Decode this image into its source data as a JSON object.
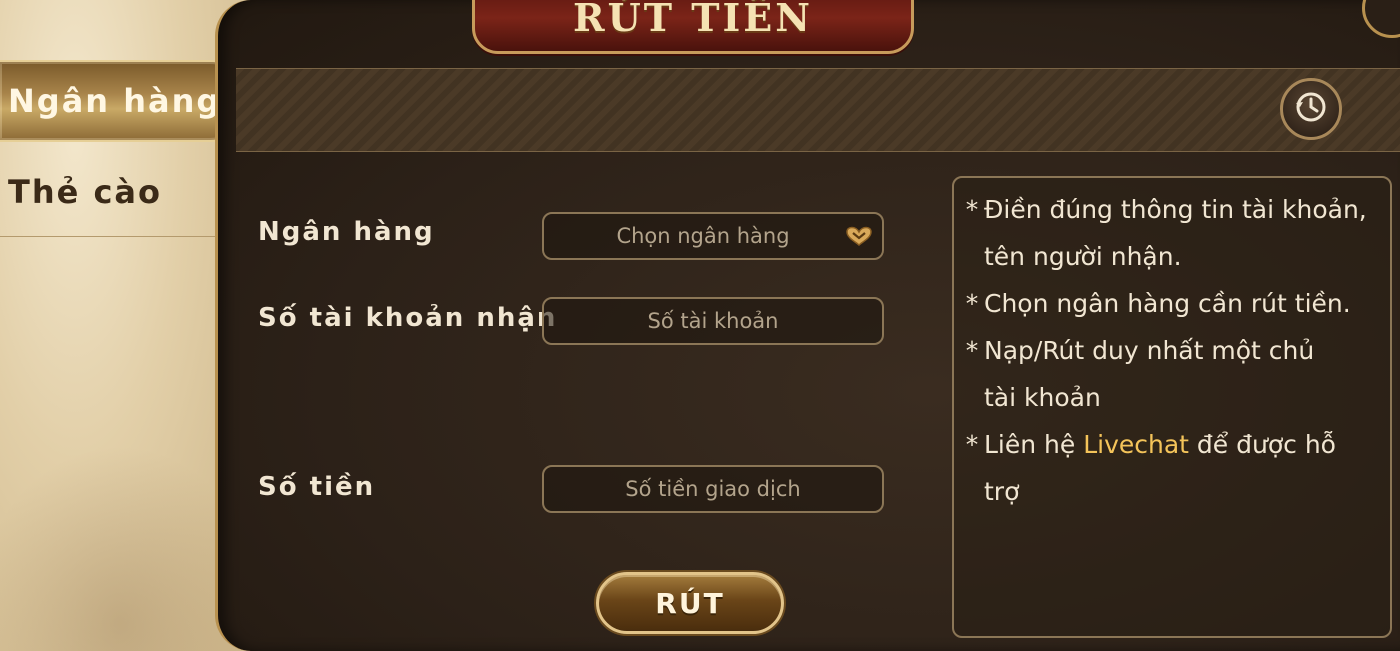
{
  "title": "RÚT TIỀN",
  "sidebar": {
    "items": [
      {
        "label": "Ngân hàng",
        "active": true
      },
      {
        "label": "Thẻ cào",
        "active": false
      }
    ]
  },
  "form": {
    "bank_label": "Ngân hàng",
    "bank_placeholder": "Chọn ngân hàng",
    "account_label": "Số tài khoản nhận",
    "account_placeholder": "Số tài khoản",
    "amount_label": "Số tiền",
    "amount_placeholder": "Số tiền giao dịch",
    "submit_label": "RÚT"
  },
  "notes": {
    "line1": "Điền đúng thông tin tài khoản,",
    "line1b": "tên người nhận.",
    "line2": "Chọn ngân hàng cần rút tiền.",
    "line3": "Nạp/Rút duy nhất một chủ",
    "line3b": "tài khoản",
    "line4_pre": "Liên hệ ",
    "line4_link": "Livechat",
    "line4_post": " để được hỗ",
    "line4b": "trợ",
    "bullet": "*"
  },
  "icons": {
    "history": "history-icon",
    "dropdown": "chevron-down-icon"
  },
  "colors": {
    "accent": "#f4c45a",
    "gold_border": "#b8914f",
    "panel": "#2c2118"
  }
}
